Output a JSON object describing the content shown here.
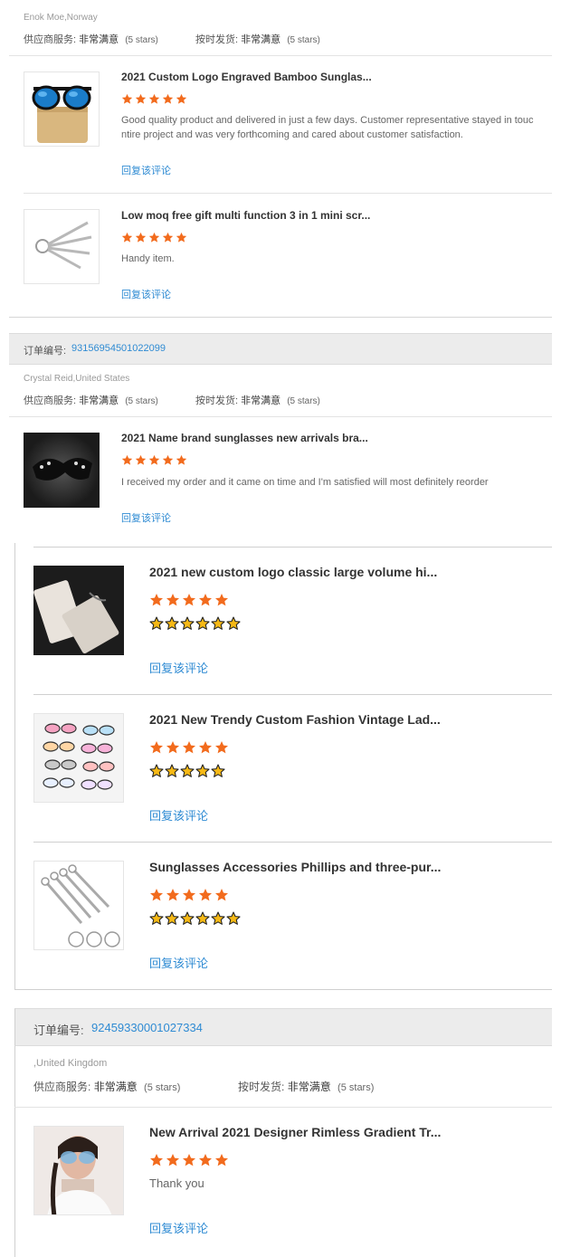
{
  "block1": {
    "buyer": "Enok Moe,Norway",
    "supplier_service_label": "供应商服务:",
    "supplier_service_value": "非常满意",
    "supplier_service_stars": "(5 stars)",
    "ontime_label": "按时发货:",
    "ontime_value": "非常满意",
    "ontime_stars": "(5 stars)",
    "items": [
      {
        "title": "2021 Custom Logo Engraved Bamboo Sunglas...",
        "rating": 5,
        "review_line1": "Good quality product and delivered in just a few days. Customer representative stayed in touc",
        "review_line2": "ntire project and was very forthcoming and cared about customer satisfaction.",
        "reply": "回复该评论"
      },
      {
        "title": "Low moq free gift multi function 3 in 1 mini scr...",
        "rating": 5,
        "review_line1": "Handy item.",
        "reply": "回复该评论"
      }
    ]
  },
  "order2": {
    "label": "订单编号:",
    "number": "93156954501022099",
    "buyer": "Crystal Reid,United States",
    "supplier_service_label": "供应商服务:",
    "supplier_service_value": "非常满意",
    "supplier_service_stars": "(5 stars)",
    "ontime_label": "按时发货:",
    "ontime_value": "非常满意",
    "ontime_stars": "(5 stars)",
    "items": [
      {
        "title": "2021 Name brand sunglasses new arrivals bra...",
        "rating": 5,
        "review_line1": "I received my order and it came on time and I'm satisfied will most definitely reorder",
        "reply": "回复该评论"
      }
    ]
  },
  "panel3": {
    "items": [
      {
        "title": "2021 new custom logo classic large volume hi...",
        "rating": 5,
        "yellow_stars": 6,
        "reply": "回复该评论"
      },
      {
        "title": "2021 New Trendy Custom Fashion Vintage Lad...",
        "rating": 5,
        "yellow_stars": 5,
        "reply": "回复该评论"
      },
      {
        "title": "Sunglasses Accessories Phillips and three-pur...",
        "rating": 5,
        "yellow_stars": 6,
        "reply": "回复该评论"
      }
    ]
  },
  "order4": {
    "label": "订单编号:",
    "number": "92459330001027334",
    "buyer": ",United Kingdom",
    "supplier_service_label": "供应商服务:",
    "supplier_service_value": "非常满意",
    "supplier_service_stars": "(5 stars)",
    "ontime_label": "按时发货:",
    "ontime_value": "非常满意",
    "ontime_stars": "(5 stars)",
    "items": [
      {
        "title": "New Arrival 2021 Designer Rimless Gradient Tr...",
        "rating": 5,
        "review_line1": "Thank you",
        "reply": "回复该评论"
      }
    ]
  },
  "colors": {
    "accent_orange": "#f26b1d",
    "link_blue": "#2f8bd3",
    "yellow_star": "#f6b916"
  }
}
